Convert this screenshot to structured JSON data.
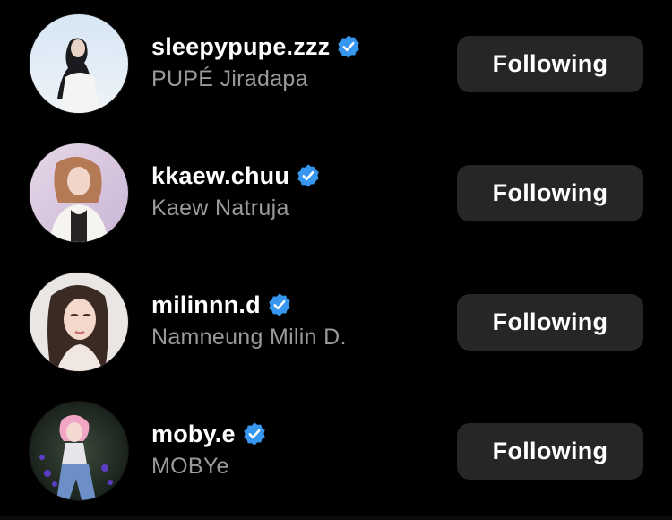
{
  "accent": "#3797f0",
  "following_list": [
    {
      "username": "sleepypupe.zzz",
      "full_name": "PUPÉ Jiradapa",
      "verified": true,
      "button_label": "Following"
    },
    {
      "username": "kkaew.chuu",
      "full_name": "Kaew Natruja",
      "verified": true,
      "button_label": "Following"
    },
    {
      "username": "milinnn.d",
      "full_name": "Namneung Milin D.",
      "verified": true,
      "button_label": "Following"
    },
    {
      "username": "moby.e",
      "full_name": "MOBYe",
      "verified": true,
      "button_label": "Following"
    }
  ]
}
